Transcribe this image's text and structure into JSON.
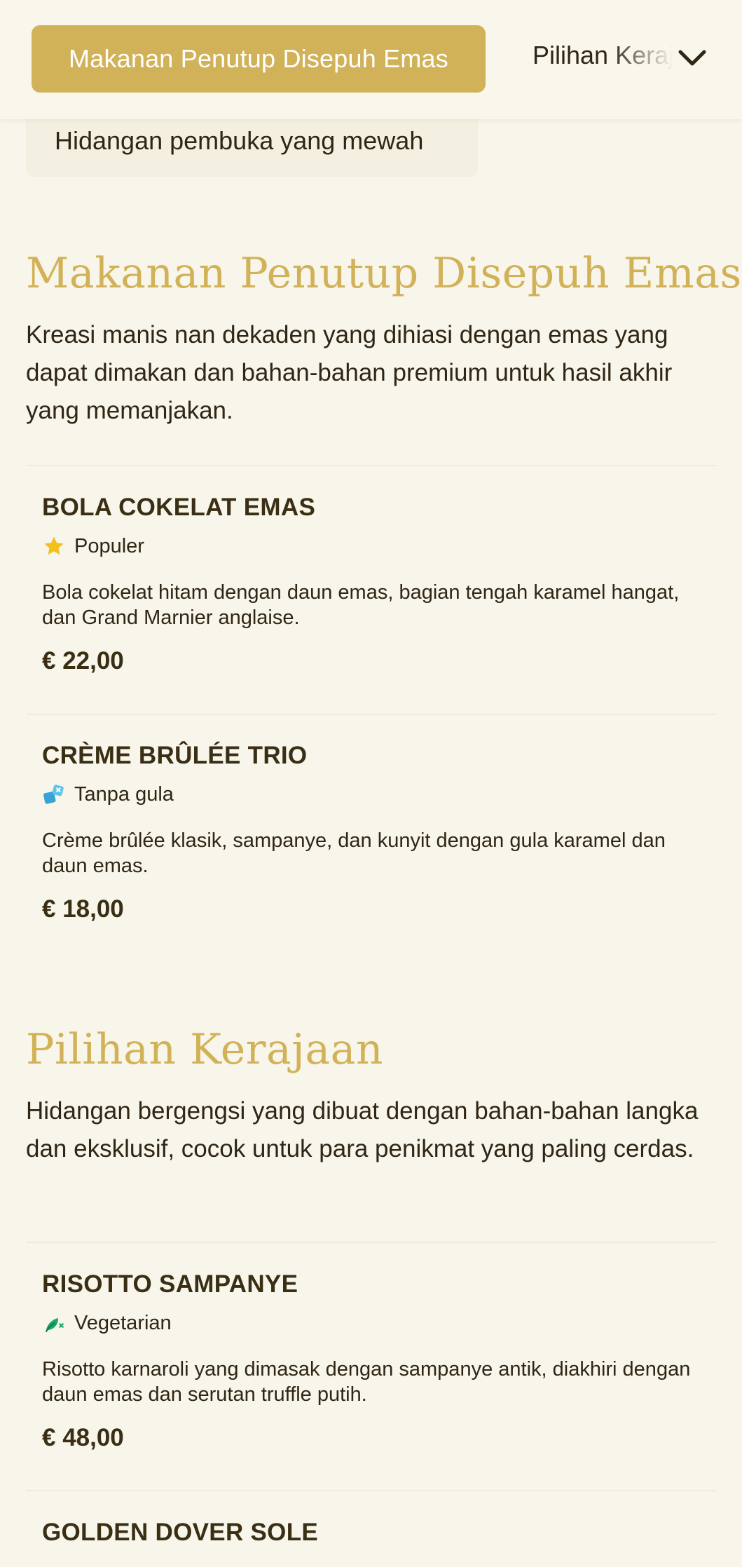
{
  "header": {
    "active_category": "Makanan Penutup Disepuh Emas",
    "next_category": "Pilihan Kerajaan",
    "dropdown_icon": "chevron-down-icon"
  },
  "prev_section": {
    "card_text": "Hidangan pembuka yang mewah"
  },
  "sections": [
    {
      "title": "Makanan Penutup Disepuh Emas",
      "description": "Kreasi manis nan dekaden yang dihiasi dengan emas yang dapat dimakan dan bahan-bahan premium untuk hasil akhir yang memanjakan.",
      "items": [
        {
          "name": "BOLA COKELAT EMAS",
          "badge": "Populer",
          "badge_icon": "star-icon",
          "description": "Bola cokelat hitam dengan daun emas, bagian tengah karamel hangat, dan Grand Marnier anglaise.",
          "price": "€ 22,00"
        },
        {
          "name": "CRÈME BRÛLÉE TRIO",
          "badge": "Tanpa gula",
          "badge_icon": "sugar-free-icon",
          "description": "Crème brûlée klasik, sampanye, dan kunyit dengan gula karamel dan daun emas.",
          "price": "€ 18,00"
        }
      ]
    },
    {
      "title": "Pilihan Kerajaan",
      "description": "Hidangan bergengsi yang dibuat dengan bahan-bahan langka dan eksklusif, cocok untuk para penikmat yang paling cerdas.",
      "items": [
        {
          "name": "RISOTTO SAMPANYE",
          "badge": "Vegetarian",
          "badge_icon": "vegetarian-icon",
          "description": "Risotto karnaroli yang dimasak dengan sampanye antik, diakhiri dengan daun emas dan serutan truffle putih.",
          "price": "€ 48,00"
        },
        {
          "name": "GOLDEN DOVER SOLE"
        }
      ]
    }
  ],
  "colors": {
    "gold": "#d2b258",
    "background": "#f8f5ea",
    "text": "#2f2615"
  }
}
